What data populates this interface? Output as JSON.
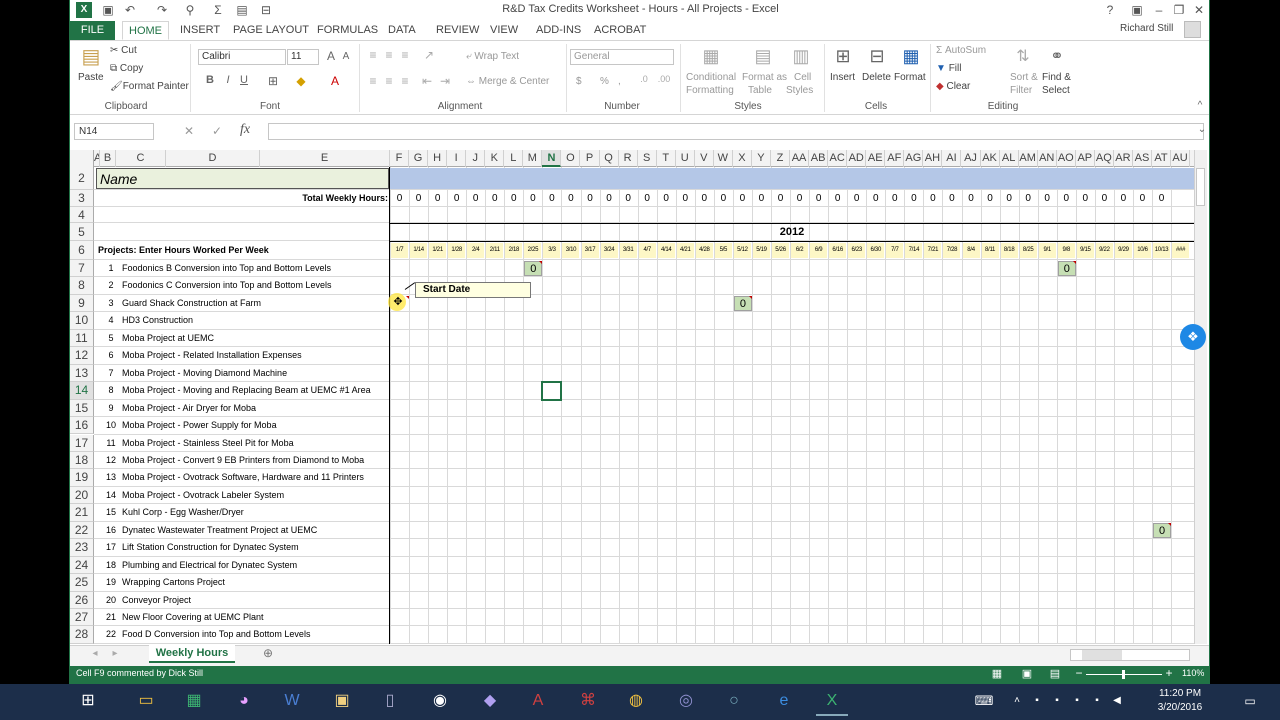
{
  "window": {
    "title": "R&D Tax Credits Worksheet - Hours - All Projects - Excel",
    "user": "Richard Still",
    "help": "?",
    "minimize": "–",
    "restore": "❐",
    "close": "✕"
  },
  "tabs": [
    "FILE",
    "HOME",
    "INSERT",
    "PAGE LAYOUT",
    "FORMULAS",
    "DATA",
    "REVIEW",
    "VIEW",
    "ADD-INS",
    "ACROBAT"
  ],
  "ribbon": {
    "clipboard": {
      "label": "Clipboard",
      "paste": "Paste",
      "cut": "Cut",
      "copy": "Copy",
      "format_painter": "Format Painter"
    },
    "font": {
      "label": "Font",
      "name": "Calibri",
      "size": "11",
      "bold": "B",
      "italic": "I",
      "underline": "U"
    },
    "alignment": {
      "label": "Alignment",
      "wrap": "Wrap Text",
      "merge": "Merge & Center"
    },
    "number": {
      "label": "Number",
      "format": "General",
      "currency": "$",
      "percent": "%",
      "comma": ","
    },
    "styles": {
      "label": "Styles",
      "conditional1": "Conditional",
      "conditional2": "Formatting",
      "format_table1": "Format as",
      "format_table2": "Table",
      "cell_styles1": "Cell",
      "cell_styles2": "Styles"
    },
    "cells": {
      "label": "Cells",
      "insert": "Insert",
      "delete": "Delete",
      "format": "Format"
    },
    "editing": {
      "label": "Editing",
      "autosum": "AutoSum",
      "fill": "Fill",
      "clear": "Clear",
      "sort1": "Sort &",
      "sort2": "Filter",
      "find1": "Find &",
      "find2": "Select"
    }
  },
  "formula_bar": {
    "name_box": "N14",
    "fx": "fx",
    "value": ""
  },
  "columns": [
    "A",
    "B",
    "C",
    "D",
    "E",
    "F",
    "G",
    "H",
    "I",
    "J",
    "K",
    "L",
    "M",
    "N",
    "O",
    "P",
    "Q",
    "R",
    "S",
    "T",
    "U",
    "V",
    "W",
    "X",
    "Y",
    "Z",
    "AA",
    "AB",
    "AC",
    "AD",
    "AE",
    "AF",
    "AG",
    "AH",
    "AI",
    "AJ",
    "AK",
    "AL",
    "AM",
    "AN",
    "AO",
    "AP",
    "AQ",
    "AR",
    "AS",
    "AT",
    "AU"
  ],
  "selected_column": "N",
  "rows": [
    "2",
    "3",
    "4",
    "5",
    "6",
    "7",
    "8",
    "9",
    "10",
    "11",
    "12",
    "13",
    "14",
    "15",
    "16",
    "17",
    "18",
    "19",
    "20",
    "21",
    "22",
    "23",
    "24",
    "25",
    "26",
    "27",
    "28"
  ],
  "selected_row": "14",
  "sheet": {
    "name_label": "Name",
    "total_label": "Total Weekly Hours:",
    "total_value": "0",
    "year": "2012",
    "projects_header": "Projects:  Enter Hours Worked Per Week",
    "dates": [
      "1/7",
      "1/14",
      "1/21",
      "1/28",
      "2/4",
      "2/11",
      "2/18",
      "2/25",
      "3/3",
      "3/10",
      "3/17",
      "3/24",
      "3/31",
      "4/7",
      "4/14",
      "4/21",
      "4/28",
      "5/5",
      "5/12",
      "5/19",
      "5/26",
      "6/2",
      "6/9",
      "6/16",
      "6/23",
      "6/30",
      "7/7",
      "7/14",
      "7/21",
      "7/28",
      "8/4",
      "8/11",
      "8/18",
      "8/25",
      "9/1",
      "9/8",
      "9/15",
      "9/22",
      "9/29",
      "10/6",
      "10/13",
      "###"
    ],
    "projects": [
      {
        "n": "1",
        "name": "Foodonics B Conversion into Top and Bottom Levels"
      },
      {
        "n": "2",
        "name": "Foodonics C Conversion into Top and Bottom Levels"
      },
      {
        "n": "3",
        "name": "Guard Shack Construction at Farm"
      },
      {
        "n": "4",
        "name": "HD3 Construction"
      },
      {
        "n": "5",
        "name": "Moba Project at UEMC"
      },
      {
        "n": "6",
        "name": "Moba Project - Related Installation Expenses"
      },
      {
        "n": "7",
        "name": "Moba Project - Moving Diamond Machine"
      },
      {
        "n": "8",
        "name": "Moba Project - Moving and Replacing Beam at UEMC #1 Area"
      },
      {
        "n": "9",
        "name": "Moba Project - Air Dryer for Moba"
      },
      {
        "n": "10",
        "name": "Moba Project - Power Supply for Moba"
      },
      {
        "n": "11",
        "name": "Moba Project - Stainless Steel Pit for Moba"
      },
      {
        "n": "12",
        "name": "Moba Project - Convert 9 EB Printers from Diamond to Moba"
      },
      {
        "n": "13",
        "name": "Moba Project - Ovotrack Software, Hardware and 11 Printers"
      },
      {
        "n": "14",
        "name": "Moba Project - Ovotrack Labeler System"
      },
      {
        "n": "15",
        "name": "Kuhl Corp - Egg Washer/Dryer"
      },
      {
        "n": "16",
        "name": "Dynatec Wastewater Treatment Project at UEMC"
      },
      {
        "n": "17",
        "name": "Lift Station Construction for Dynatec System"
      },
      {
        "n": "18",
        "name": "Plumbing and Electrical for Dynatec System"
      },
      {
        "n": "19",
        "name": "Wrapping Cartons Project"
      },
      {
        "n": "20",
        "name": "Conveyor Project"
      },
      {
        "n": "21",
        "name": "New Floor Covering at UEMC Plant"
      },
      {
        "n": "22",
        "name": "Food D Conversion into Top and Bottom Levels"
      }
    ],
    "start_date_comment": "Start Date",
    "cell_zero": "0"
  },
  "sheet_tabs": [
    "Weekly Hours"
  ],
  "status": {
    "text": "Cell F9 commented by Dick Still",
    "zoom": "110%"
  },
  "taskbar": {
    "time": "11:20 PM",
    "date": "3/20/2016"
  }
}
